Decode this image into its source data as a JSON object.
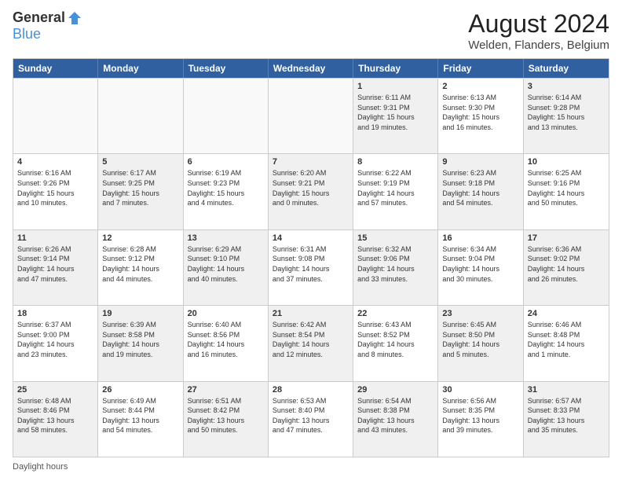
{
  "header": {
    "logo_general": "General",
    "logo_blue": "Blue",
    "main_title": "August 2024",
    "subtitle": "Welden, Flanders, Belgium"
  },
  "days_of_week": [
    "Sunday",
    "Monday",
    "Tuesday",
    "Wednesday",
    "Thursday",
    "Friday",
    "Saturday"
  ],
  "footer_label": "Daylight hours",
  "weeks": [
    [
      {
        "num": "",
        "info": "",
        "empty": true
      },
      {
        "num": "",
        "info": "",
        "empty": true
      },
      {
        "num": "",
        "info": "",
        "empty": true
      },
      {
        "num": "",
        "info": "",
        "empty": true
      },
      {
        "num": "1",
        "info": "Sunrise: 6:11 AM\nSunset: 9:31 PM\nDaylight: 15 hours\nand 19 minutes.",
        "shaded": true
      },
      {
        "num": "2",
        "info": "Sunrise: 6:13 AM\nSunset: 9:30 PM\nDaylight: 15 hours\nand 16 minutes.",
        "shaded": false
      },
      {
        "num": "3",
        "info": "Sunrise: 6:14 AM\nSunset: 9:28 PM\nDaylight: 15 hours\nand 13 minutes.",
        "shaded": true
      }
    ],
    [
      {
        "num": "4",
        "info": "Sunrise: 6:16 AM\nSunset: 9:26 PM\nDaylight: 15 hours\nand 10 minutes.",
        "shaded": false
      },
      {
        "num": "5",
        "info": "Sunrise: 6:17 AM\nSunset: 9:25 PM\nDaylight: 15 hours\nand 7 minutes.",
        "shaded": true
      },
      {
        "num": "6",
        "info": "Sunrise: 6:19 AM\nSunset: 9:23 PM\nDaylight: 15 hours\nand 4 minutes.",
        "shaded": false
      },
      {
        "num": "7",
        "info": "Sunrise: 6:20 AM\nSunset: 9:21 PM\nDaylight: 15 hours\nand 0 minutes.",
        "shaded": true
      },
      {
        "num": "8",
        "info": "Sunrise: 6:22 AM\nSunset: 9:19 PM\nDaylight: 14 hours\nand 57 minutes.",
        "shaded": false
      },
      {
        "num": "9",
        "info": "Sunrise: 6:23 AM\nSunset: 9:18 PM\nDaylight: 14 hours\nand 54 minutes.",
        "shaded": true
      },
      {
        "num": "10",
        "info": "Sunrise: 6:25 AM\nSunset: 9:16 PM\nDaylight: 14 hours\nand 50 minutes.",
        "shaded": false
      }
    ],
    [
      {
        "num": "11",
        "info": "Sunrise: 6:26 AM\nSunset: 9:14 PM\nDaylight: 14 hours\nand 47 minutes.",
        "shaded": true
      },
      {
        "num": "12",
        "info": "Sunrise: 6:28 AM\nSunset: 9:12 PM\nDaylight: 14 hours\nand 44 minutes.",
        "shaded": false
      },
      {
        "num": "13",
        "info": "Sunrise: 6:29 AM\nSunset: 9:10 PM\nDaylight: 14 hours\nand 40 minutes.",
        "shaded": true
      },
      {
        "num": "14",
        "info": "Sunrise: 6:31 AM\nSunset: 9:08 PM\nDaylight: 14 hours\nand 37 minutes.",
        "shaded": false
      },
      {
        "num": "15",
        "info": "Sunrise: 6:32 AM\nSunset: 9:06 PM\nDaylight: 14 hours\nand 33 minutes.",
        "shaded": true
      },
      {
        "num": "16",
        "info": "Sunrise: 6:34 AM\nSunset: 9:04 PM\nDaylight: 14 hours\nand 30 minutes.",
        "shaded": false
      },
      {
        "num": "17",
        "info": "Sunrise: 6:36 AM\nSunset: 9:02 PM\nDaylight: 14 hours\nand 26 minutes.",
        "shaded": true
      }
    ],
    [
      {
        "num": "18",
        "info": "Sunrise: 6:37 AM\nSunset: 9:00 PM\nDaylight: 14 hours\nand 23 minutes.",
        "shaded": false
      },
      {
        "num": "19",
        "info": "Sunrise: 6:39 AM\nSunset: 8:58 PM\nDaylight: 14 hours\nand 19 minutes.",
        "shaded": true
      },
      {
        "num": "20",
        "info": "Sunrise: 6:40 AM\nSunset: 8:56 PM\nDaylight: 14 hours\nand 16 minutes.",
        "shaded": false
      },
      {
        "num": "21",
        "info": "Sunrise: 6:42 AM\nSunset: 8:54 PM\nDaylight: 14 hours\nand 12 minutes.",
        "shaded": true
      },
      {
        "num": "22",
        "info": "Sunrise: 6:43 AM\nSunset: 8:52 PM\nDaylight: 14 hours\nand 8 minutes.",
        "shaded": false
      },
      {
        "num": "23",
        "info": "Sunrise: 6:45 AM\nSunset: 8:50 PM\nDaylight: 14 hours\nand 5 minutes.",
        "shaded": true
      },
      {
        "num": "24",
        "info": "Sunrise: 6:46 AM\nSunset: 8:48 PM\nDaylight: 14 hours\nand 1 minute.",
        "shaded": false
      }
    ],
    [
      {
        "num": "25",
        "info": "Sunrise: 6:48 AM\nSunset: 8:46 PM\nDaylight: 13 hours\nand 58 minutes.",
        "shaded": true
      },
      {
        "num": "26",
        "info": "Sunrise: 6:49 AM\nSunset: 8:44 PM\nDaylight: 13 hours\nand 54 minutes.",
        "shaded": false
      },
      {
        "num": "27",
        "info": "Sunrise: 6:51 AM\nSunset: 8:42 PM\nDaylight: 13 hours\nand 50 minutes.",
        "shaded": true
      },
      {
        "num": "28",
        "info": "Sunrise: 6:53 AM\nSunset: 8:40 PM\nDaylight: 13 hours\nand 47 minutes.",
        "shaded": false
      },
      {
        "num": "29",
        "info": "Sunrise: 6:54 AM\nSunset: 8:38 PM\nDaylight: 13 hours\nand 43 minutes.",
        "shaded": true
      },
      {
        "num": "30",
        "info": "Sunrise: 6:56 AM\nSunset: 8:35 PM\nDaylight: 13 hours\nand 39 minutes.",
        "shaded": false
      },
      {
        "num": "31",
        "info": "Sunrise: 6:57 AM\nSunset: 8:33 PM\nDaylight: 13 hours\nand 35 minutes.",
        "shaded": true
      }
    ]
  ]
}
